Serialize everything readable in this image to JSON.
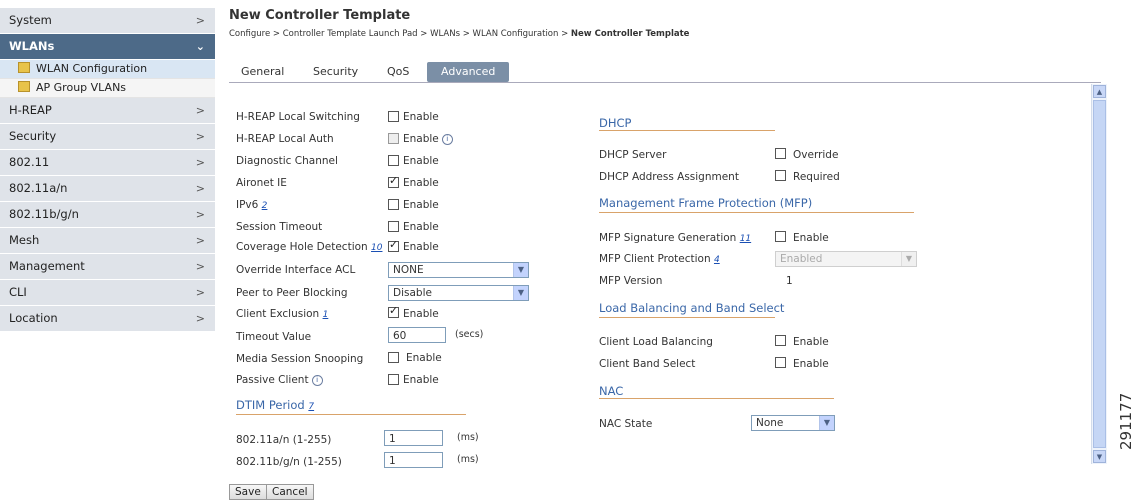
{
  "sidebar": {
    "items": [
      {
        "label": "System"
      },
      {
        "label": "WLANs"
      },
      {
        "label": "H-REAP"
      },
      {
        "label": "Security"
      },
      {
        "label": "802.11"
      },
      {
        "label": "802.11a/n"
      },
      {
        "label": "802.11b/g/n"
      },
      {
        "label": "Mesh"
      },
      {
        "label": "Management"
      },
      {
        "label": "CLI"
      },
      {
        "label": "Location"
      }
    ],
    "subitems": [
      {
        "label": "WLAN Configuration"
      },
      {
        "label": "AP Group VLANs"
      }
    ]
  },
  "page": {
    "title": "New Controller Template",
    "breadcrumb": "Configure > Controller Template Launch Pad > WLANs > WLAN Configuration > ",
    "breadcrumb_current": "New Controller Template"
  },
  "tabs": [
    {
      "label": "General"
    },
    {
      "label": "Security"
    },
    {
      "label": "QoS"
    },
    {
      "label": "Advanced"
    }
  ],
  "left": {
    "hreap_local_switching": "H-REAP Local Switching",
    "hreap_local_auth": "H-REAP Local Auth",
    "diagnostic_channel": "Diagnostic Channel",
    "aironet_ie": "Aironet IE",
    "ipv6": "IPv6",
    "ipv6_ref": "2",
    "session_timeout": "Session Timeout",
    "coverage_hole": "Coverage Hole Detection",
    "coverage_hole_ref": "10",
    "override_acl": "Override Interface ACL",
    "override_acl_value": "NONE",
    "p2p_blocking": "Peer to Peer Blocking",
    "p2p_blocking_value": "Disable",
    "client_exclusion": "Client Exclusion",
    "client_exclusion_ref": "1",
    "timeout_value": "Timeout Value",
    "timeout_value_val": "60",
    "timeout_unit": "(secs)",
    "media_snooping": "Media Session Snooping",
    "passive_client": "Passive Client",
    "enable": "Enable",
    "dtim_title": "DTIM Period",
    "dtim_ref": "7",
    "dtim_a": "802.11a/n (1-255)",
    "dtim_a_val": "1",
    "dtim_b": "802.11b/g/n (1-255)",
    "dtim_b_val": "1",
    "ms": "(ms)"
  },
  "right": {
    "dhcp_title": "DHCP",
    "dhcp_server": "DHCP Server",
    "override": "Override",
    "dhcp_assign": "DHCP Address Assignment",
    "required": "Required",
    "mfp_title": "Management Frame Protection (MFP)",
    "mfp_sig": "MFP Signature Generation",
    "mfp_sig_ref": "11",
    "mfp_client": "MFP Client Protection",
    "mfp_client_ref": "4",
    "mfp_client_value": "Enabled",
    "mfp_version": "MFP Version",
    "mfp_version_value": "1",
    "lb_title": "Load Balancing and Band Select",
    "client_lb": "Client Load Balancing",
    "client_bs": "Client Band Select",
    "enable": "Enable",
    "nac_title": "NAC",
    "nac_state": "NAC State",
    "nac_value": "None"
  },
  "footer": {
    "save": "Save",
    "cancel": "Cancel",
    "figure_id": "291177"
  }
}
